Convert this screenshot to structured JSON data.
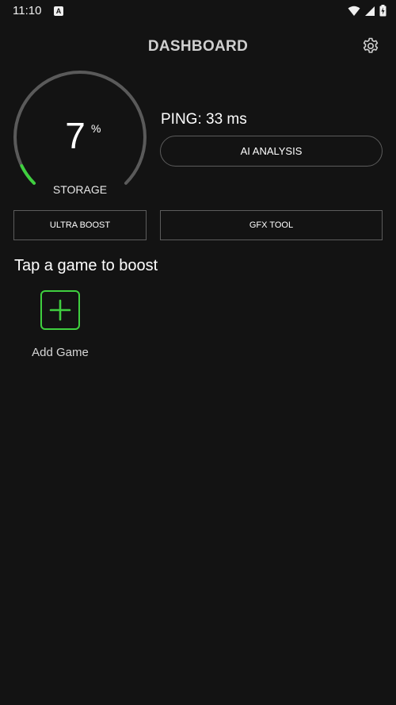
{
  "status_bar": {
    "time": "11:10",
    "notification_badge": "A"
  },
  "header": {
    "title": "DASHBOARD",
    "settings_icon": "gear-icon"
  },
  "gauge": {
    "value": "7",
    "unit": "%",
    "label": "STORAGE",
    "fraction": 0.07,
    "track_color": "#5a5a5a",
    "fill_color": "#3fcf3f"
  },
  "ping": "PING: 33 ms",
  "buttons": {
    "ai_analysis": "AI ANALYSIS",
    "ultra_boost": "ULTRA BOOST",
    "gfx_tool": "GFX TOOL"
  },
  "games": {
    "title": "Tap a game to boost",
    "add_label": "Add Game"
  },
  "colors": {
    "background": "#131313",
    "accent": "#3fcf3f"
  }
}
